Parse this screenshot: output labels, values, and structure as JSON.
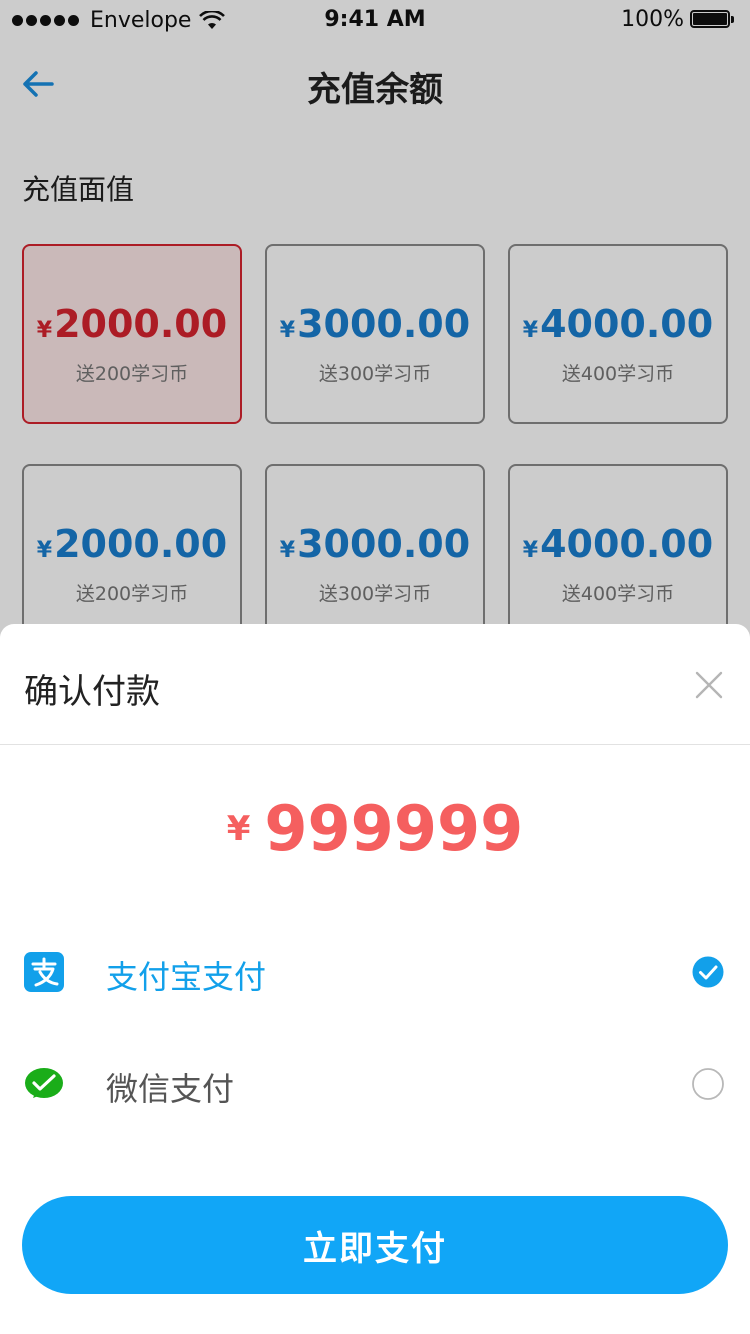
{
  "status_bar": {
    "carrier": "Envelope",
    "time": "9:41 AM",
    "battery": "100%"
  },
  "nav": {
    "title": "充值余额",
    "back_icon": "arrow-left-icon"
  },
  "recharge": {
    "section_title": "充值面值",
    "currency_symbol": "¥",
    "options": [
      {
        "amount": "2000.00",
        "bonus": "送200学习币",
        "selected": true
      },
      {
        "amount": "3000.00",
        "bonus": "送300学习币",
        "selected": false
      },
      {
        "amount": "4000.00",
        "bonus": "送400学习币",
        "selected": false
      },
      {
        "amount": "2000.00",
        "bonus": "送200学习币",
        "selected": false
      },
      {
        "amount": "3000.00",
        "bonus": "送300学习币",
        "selected": false
      },
      {
        "amount": "4000.00",
        "bonus": "送400学习币",
        "selected": false
      }
    ]
  },
  "payment_sheet": {
    "title": "确认付款",
    "close_icon": "close-icon",
    "amount_symbol": "¥",
    "amount": "999999",
    "methods": [
      {
        "label": "支付宝支付",
        "icon": "alipay-icon",
        "selected": true
      },
      {
        "label": "微信支付",
        "icon": "wechat-pay-icon",
        "selected": false
      }
    ],
    "pay_button_label": "立即支付"
  },
  "colors": {
    "primary_blue": "#11a6f7",
    "price_blue": "#1a7fd0",
    "selected_red": "#d8242f",
    "amount_red": "#f55f5f",
    "wechat_green": "#1aad19"
  }
}
